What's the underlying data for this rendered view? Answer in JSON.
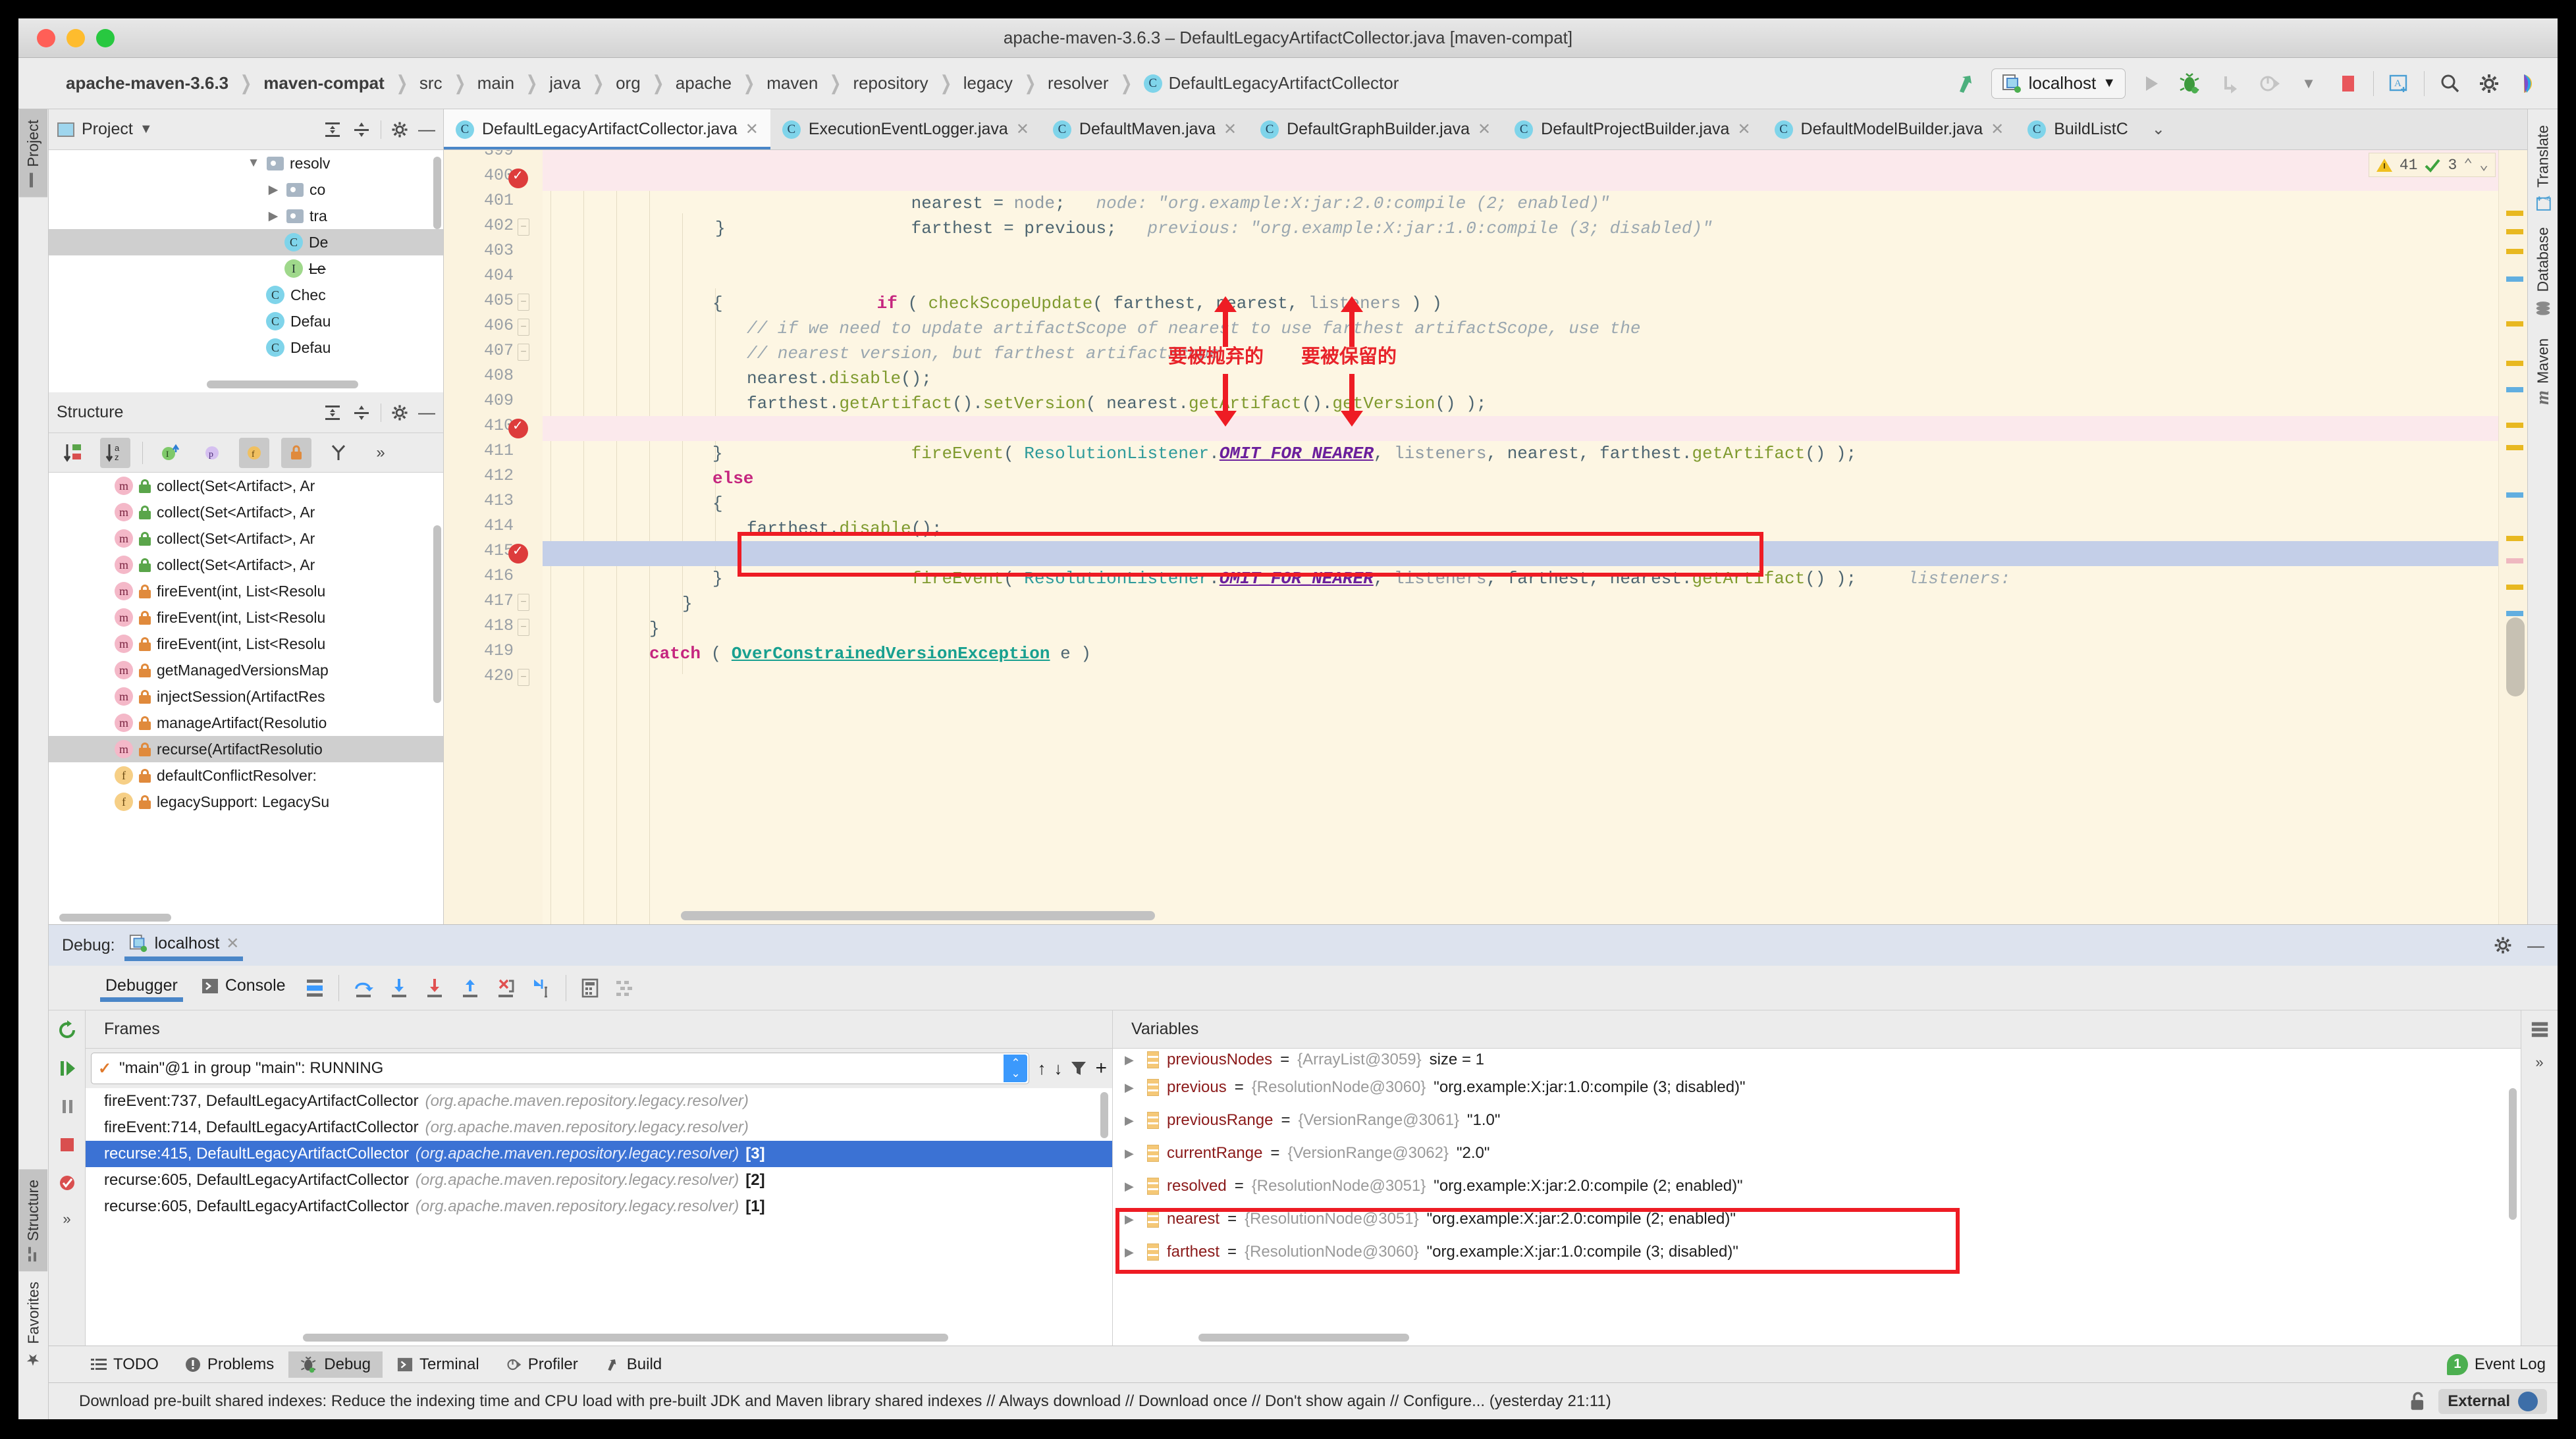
{
  "window": {
    "title": "apache-maven-3.6.3 – DefaultLegacyArtifactCollector.java [maven-compat]"
  },
  "breadcrumb": {
    "items": [
      "apache-maven-3.6.3",
      "maven-compat",
      "src",
      "main",
      "java",
      "org",
      "apache",
      "maven",
      "repository",
      "legacy",
      "resolver"
    ],
    "current_class": "DefaultLegacyArtifactCollector",
    "class_icon": "C"
  },
  "toolbar": {
    "run_config": "localhost",
    "icons": [
      "build-icon",
      "run-config-selector",
      "run-icon",
      "debug-icon",
      "step-over-icon",
      "profile-icon",
      "stop-icon",
      "translate-icon",
      "search-everywhere-icon",
      "settings-icon",
      "idea-logo-icon"
    ]
  },
  "left_strip": {
    "tabs": [
      "Project",
      "Structure",
      "Favorites"
    ]
  },
  "right_strip": {
    "tabs": [
      "Translate",
      "Database",
      "Maven"
    ]
  },
  "project_panel": {
    "title": "Project",
    "rows": [
      {
        "indent": 3,
        "arrow": "▼",
        "icon": "folder",
        "label": "resolv"
      },
      {
        "indent": 4,
        "arrow": "▶",
        "icon": "folder",
        "label": "co"
      },
      {
        "indent": 4,
        "arrow": "▶",
        "icon": "folder",
        "label": "tra"
      },
      {
        "indent": 5,
        "arrow": "",
        "icon": "class",
        "label": "De",
        "selected": true
      },
      {
        "indent": 5,
        "arrow": "",
        "icon": "interface",
        "label": "Le"
      },
      {
        "indent": 4,
        "arrow": "",
        "icon": "class",
        "label": "Chec"
      },
      {
        "indent": 4,
        "arrow": "",
        "icon": "class",
        "label": "Defau"
      },
      {
        "indent": 4,
        "arrow": "",
        "icon": "class",
        "label": "Defau"
      }
    ]
  },
  "structure_panel": {
    "title": "Structure",
    "toolbar_icons": [
      "sort-by-visibility-icon",
      "sort-alphabetically-icon",
      "show-inherited-icon",
      "show-properties-icon",
      "show-fields-icon",
      "show-non-public-icon",
      "show-hierarchy-icon",
      "more-icon"
    ],
    "rows": [
      {
        "kind": "m",
        "lock": "green",
        "label": "collect(Set<Artifact>, Ar"
      },
      {
        "kind": "m",
        "lock": "green",
        "label": "collect(Set<Artifact>, Ar"
      },
      {
        "kind": "m",
        "lock": "green",
        "label": "collect(Set<Artifact>, Ar"
      },
      {
        "kind": "m",
        "lock": "green",
        "label": "collect(Set<Artifact>, Ar"
      },
      {
        "kind": "m",
        "lock": "orange",
        "label": "fireEvent(int, List<Resolu"
      },
      {
        "kind": "m",
        "lock": "orange",
        "label": "fireEvent(int, List<Resolu"
      },
      {
        "kind": "m",
        "lock": "orange",
        "label": "fireEvent(int, List<Resolu"
      },
      {
        "kind": "m",
        "lock": "orange",
        "label": "getManagedVersionsMap"
      },
      {
        "kind": "m",
        "lock": "orange",
        "label": "injectSession(ArtifactRes"
      },
      {
        "kind": "m",
        "lock": "orange",
        "label": "manageArtifact(Resolutio"
      },
      {
        "kind": "m",
        "lock": "orange",
        "label": "recurse(ArtifactResolutio",
        "selected": true
      },
      {
        "kind": "f",
        "lock": "orange",
        "label": "defaultConflictResolver:"
      },
      {
        "kind": "f",
        "lock": "orange",
        "label": "legacySupport: LegacySu"
      }
    ]
  },
  "editor_tabs": [
    {
      "label": "DefaultLegacyArtifactCollector.java",
      "active": true
    },
    {
      "label": "ExecutionEventLogger.java",
      "active": false
    },
    {
      "label": "DefaultMaven.java",
      "active": false
    },
    {
      "label": "DefaultGraphBuilder.java",
      "active": false
    },
    {
      "label": "DefaultProjectBuilder.java",
      "active": false
    },
    {
      "label": "DefaultModelBuilder.java",
      "active": false
    },
    {
      "label": "BuildListC",
      "active": false
    }
  ],
  "inspection": {
    "warnings": "41",
    "oks": "3"
  },
  "code": {
    "first_line": 400,
    "lines": [
      {
        "n": 399,
        "tokens": [],
        "partial": true
      },
      {
        "n": 400,
        "breakpoint": true,
        "highlight": "pink",
        "tokens": [
          {
            "t": "                    ",
            "c": "pun"
          },
          {
            "t": "nearest",
            "c": "id"
          },
          {
            "t": " = ",
            "c": "pun"
          },
          {
            "t": "node",
            "c": "gray"
          },
          {
            "t": ";   ",
            "c": "pun"
          },
          {
            "t": "node: \"org.example:X:jar:2.0:compile (2; enabled)\"",
            "c": "hint"
          }
        ]
      },
      {
        "n": 401,
        "tokens": [
          {
            "t": "                    ",
            "c": "pun"
          },
          {
            "t": "farthest",
            "c": "id"
          },
          {
            "t": " = ",
            "c": "pun"
          },
          {
            "t": "previous",
            "c": "id"
          },
          {
            "t": ";   ",
            "c": "pun"
          },
          {
            "t": "previous: \"org.example:X:jar:1.0:compile (3; disabled)\"",
            "c": "hint"
          }
        ]
      },
      {
        "n": 402,
        "fold": true,
        "tokens": [
          {
            "t": "                }",
            "c": "pun"
          }
        ]
      },
      {
        "n": 403,
        "tokens": []
      },
      {
        "n": 404,
        "tokens": [
          {
            "t": "                ",
            "c": "pun"
          },
          {
            "t": "if",
            "c": "kw"
          },
          {
            "t": " ( ",
            "c": "pun"
          },
          {
            "t": "checkScopeUpdate",
            "c": "fn"
          },
          {
            "t": "( ",
            "c": "pun"
          },
          {
            "t": "farthest, nearest, ",
            "c": "id"
          },
          {
            "t": "listeners",
            "c": "gray"
          },
          {
            "t": " ) )",
            "c": "pun"
          }
        ]
      },
      {
        "n": 405,
        "fold": true,
        "tokens": [
          {
            "t": "                {",
            "c": "pun"
          }
        ]
      },
      {
        "n": 406,
        "fold": true,
        "tokens": [
          {
            "t": "                    ",
            "c": "pun"
          },
          {
            "t": "// if we need to update artifactScope of nearest to use farthest artifactScope, use the",
            "c": "cmt"
          }
        ]
      },
      {
        "n": 407,
        "fold": true,
        "tokens": [
          {
            "t": "                    ",
            "c": "pun"
          },
          {
            "t": "// nearest version, but farthest artifactScope",
            "c": "cmt"
          }
        ]
      },
      {
        "n": 408,
        "tokens": [
          {
            "t": "                    ",
            "c": "pun"
          },
          {
            "t": "nearest.",
            "c": "id"
          },
          {
            "t": "disable",
            "c": "fn"
          },
          {
            "t": "();",
            "c": "pun"
          }
        ]
      },
      {
        "n": 409,
        "tokens": [
          {
            "t": "                    ",
            "c": "pun"
          },
          {
            "t": "farthest.",
            "c": "id"
          },
          {
            "t": "getArtifact",
            "c": "fn"
          },
          {
            "t": "().",
            "c": "pun"
          },
          {
            "t": "setVersion",
            "c": "fn"
          },
          {
            "t": "( ",
            "c": "pun"
          },
          {
            "t": "nearest.",
            "c": "id"
          },
          {
            "t": "getArtifact",
            "c": "fn"
          },
          {
            "t": "().",
            "c": "pun"
          },
          {
            "t": "getVersion",
            "c": "fn"
          },
          {
            "t": "() );",
            "c": "pun"
          }
        ]
      },
      {
        "n": 410,
        "breakpoint": true,
        "highlight": "pink",
        "tokens": [
          {
            "t": "                    ",
            "c": "pun"
          },
          {
            "t": "fireEvent",
            "c": "fn"
          },
          {
            "t": "( ",
            "c": "pun"
          },
          {
            "t": "ResolutionListener",
            "c": "cls"
          },
          {
            "t": ".",
            "c": "pun"
          },
          {
            "t": "OMIT_FOR_NEARER",
            "c": "const"
          },
          {
            "t": ", ",
            "c": "pun"
          },
          {
            "t": "listeners",
            "c": "gray"
          },
          {
            "t": ", ",
            "c": "pun"
          },
          {
            "t": "nearest, farthest.",
            "c": "id"
          },
          {
            "t": "getArtifact",
            "c": "fn"
          },
          {
            "t": "() );",
            "c": "pun"
          }
        ]
      },
      {
        "n": 411,
        "tokens": [
          {
            "t": "                }",
            "c": "pun"
          }
        ]
      },
      {
        "n": 412,
        "tokens": [
          {
            "t": "                ",
            "c": "pun"
          },
          {
            "t": "else",
            "c": "kw"
          }
        ]
      },
      {
        "n": 413,
        "tokens": [
          {
            "t": "                {",
            "c": "pun"
          }
        ]
      },
      {
        "n": 414,
        "tokens": [
          {
            "t": "                    ",
            "c": "pun"
          },
          {
            "t": "farthest.",
            "c": "id"
          },
          {
            "t": "disable",
            "c": "fn"
          },
          {
            "t": "();",
            "c": "pun"
          }
        ]
      },
      {
        "n": 415,
        "breakpoint": true,
        "highlight": "blue",
        "boxed": true,
        "tokens": [
          {
            "t": "                    ",
            "c": "pun"
          },
          {
            "t": "fireEvent",
            "c": "fn"
          },
          {
            "t": "( ",
            "c": "pun"
          },
          {
            "t": "ResolutionListener",
            "c": "cls"
          },
          {
            "t": ".",
            "c": "pun"
          },
          {
            "t": "OMIT_FOR_NEARER",
            "c": "const"
          },
          {
            "t": ", ",
            "c": "pun"
          },
          {
            "t": "listeners",
            "c": "gray"
          },
          {
            "t": ", ",
            "c": "pun"
          },
          {
            "t": "farthest, nearest.",
            "c": "id"
          },
          {
            "t": "getArtifact",
            "c": "fn"
          },
          {
            "t": "() );",
            "c": "pun"
          },
          {
            "t": "     listeners:",
            "c": "hint"
          }
        ]
      },
      {
        "n": 416,
        "tokens": [
          {
            "t": "                }",
            "c": "pun"
          }
        ]
      },
      {
        "n": 417,
        "fold": true,
        "tokens": [
          {
            "t": "            }",
            "c": "pun"
          }
        ]
      },
      {
        "n": 418,
        "fold": true,
        "tokens": [
          {
            "t": "        }",
            "c": "pun"
          }
        ]
      },
      {
        "n": 419,
        "tokens": [
          {
            "t": "        ",
            "c": "pun"
          },
          {
            "t": "catch",
            "c": "kw"
          },
          {
            "t": " ( ",
            "c": "pun"
          },
          {
            "t": "OverConstrainedVersionException",
            "c": "link"
          },
          {
            "t": " e )",
            "c": "pun"
          }
        ]
      },
      {
        "n": 420,
        "fold": true,
        "tokens": []
      }
    ]
  },
  "annotations": {
    "discard_label": "要被抛弃的",
    "keep_label": "要被保留的"
  },
  "debug": {
    "label": "Debug:",
    "session": "localhost",
    "tabs": [
      {
        "label": "Debugger",
        "selected": true
      },
      {
        "label": "Console",
        "selected": false
      }
    ],
    "toolbar_icons": [
      "layout-icon",
      "step-over-icon",
      "step-into-icon",
      "force-step-into-icon",
      "step-out-icon",
      "drop-frame-icon",
      "run-to-cursor-icon",
      "evaluate-icon",
      "mute-breakpoints-icon"
    ],
    "side_icons": [
      "rerun-icon",
      "pause-icon",
      "stop-icon",
      "breakpoints-icon",
      "mute-icon",
      "more-icon"
    ],
    "frames_header": "Frames",
    "variables_header": "Variables",
    "thread": "\"main\"@1 in group \"main\": RUNNING",
    "frames": [
      {
        "method": "fireEvent:737, DefaultLegacyArtifactCollector",
        "pkg": "(org.apache.maven.repository.legacy.resolver)",
        "num": "",
        "selected": false
      },
      {
        "method": "fireEvent:714, DefaultLegacyArtifactCollector",
        "pkg": "(org.apache.maven.repository.legacy.resolver)",
        "num": "",
        "selected": false
      },
      {
        "method": "recurse:415, DefaultLegacyArtifactCollector",
        "pkg": "(org.apache.maven.repository.legacy.resolver)",
        "num": "[3]",
        "selected": true
      },
      {
        "method": "recurse:605, DefaultLegacyArtifactCollector",
        "pkg": "(org.apache.maven.repository.legacy.resolver)",
        "num": "[2]",
        "selected": false
      },
      {
        "method": "recurse:605, DefaultLegacyArtifactCollector",
        "pkg": "(org.apache.maven.repository.legacy.resolver)",
        "num": "[1]",
        "selected": false
      }
    ],
    "variables": [
      {
        "name": "previousNodes",
        "type": "{ArrayList@3059}",
        "value": "size = 1",
        "boxed": false,
        "clipped": true
      },
      {
        "name": "previous",
        "type": "{ResolutionNode@3060}",
        "value": "\"org.example:X:jar:1.0:compile (3; disabled)\"",
        "boxed": false
      },
      {
        "name": "previousRange",
        "type": "{VersionRange@3061}",
        "value": "\"1.0\"",
        "boxed": false
      },
      {
        "name": "currentRange",
        "type": "{VersionRange@3062}",
        "value": "\"2.0\"",
        "boxed": false
      },
      {
        "name": "resolved",
        "type": "{ResolutionNode@3051}",
        "value": "\"org.example:X:jar:2.0:compile (2; enabled)\"",
        "boxed": false
      },
      {
        "name": "nearest",
        "type": "{ResolutionNode@3051}",
        "value": "\"org.example:X:jar:2.0:compile (2; enabled)\"",
        "boxed": true
      },
      {
        "name": "farthest",
        "type": "{ResolutionNode@3060}",
        "value": "\"org.example:X:jar:1.0:compile (3; disabled)\"",
        "boxed": true
      }
    ]
  },
  "bottom_tools": [
    {
      "label": "TODO",
      "icon": "todo-icon",
      "selected": false
    },
    {
      "label": "Problems",
      "icon": "problems-icon",
      "selected": false
    },
    {
      "label": "Debug",
      "icon": "debug-icon",
      "selected": true
    },
    {
      "label": "Terminal",
      "icon": "terminal-icon",
      "selected": false
    },
    {
      "label": "Profiler",
      "icon": "profiler-icon",
      "selected": false
    },
    {
      "label": "Build",
      "icon": "build-icon",
      "selected": false
    }
  ],
  "status": {
    "message": "Download pre-built shared indexes: Reduce the indexing time and CPU load with pre-built JDK and Maven library shared indexes // Always download // Download once // Don't show again // Configure... (yesterday 21:11)",
    "event_log": "Event Log",
    "event_count": "1",
    "external": "External"
  },
  "colors": {
    "accent": "#4a86c8",
    "annotation_red": "#ee1c24",
    "selection_blue": "#3b72d4",
    "editor_bg": "#fdf6e3"
  }
}
